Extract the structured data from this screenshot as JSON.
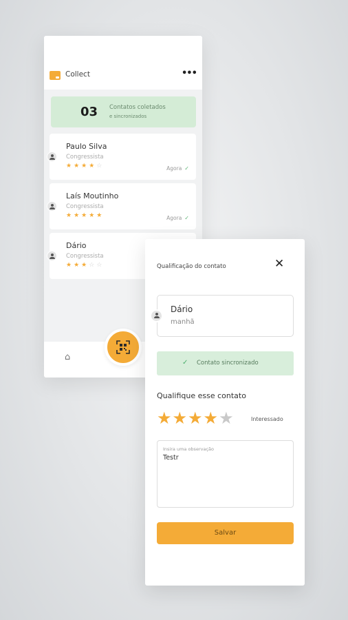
{
  "app": {
    "title": "Collect",
    "menu_icon": "more-horizontal-icon"
  },
  "summary": {
    "count": "03",
    "line1": "Contatos coletados",
    "line2": "e sincronizados"
  },
  "contacts": [
    {
      "name": "Paulo Silva",
      "role": "Congressista",
      "stars_filled": "★★★★",
      "stars_empty": "☆",
      "rating": 4,
      "status": "Agora",
      "synced": true
    },
    {
      "name": "Laís Moutinho",
      "role": "Congressista",
      "stars_filled": "★★★★★",
      "stars_empty": "",
      "rating": 5,
      "status": "Agora",
      "synced": true
    },
    {
      "name": "Dário",
      "role": "Congressista",
      "stars_filled": "★★★",
      "stars_empty": "☆☆",
      "rating": 3,
      "status": "",
      "synced": false
    }
  ],
  "nav": {
    "home_icon": "home-icon",
    "scan_icon": "qr-scan-icon"
  },
  "modal": {
    "title": "Qualificação do contato",
    "close_icon": "close-icon",
    "contact_name": "Dário",
    "contact_period": "manhã",
    "sync_text": "Contato sincronizado",
    "qualify_heading": "Qualifique esse contato",
    "rating": 4,
    "rating_max": 5,
    "rating_label": "Interessado",
    "observation_placeholder": "Insira uma observação",
    "observation_value": "Testr",
    "save_label": "Salvar"
  },
  "colors": {
    "accent": "#f4ab37",
    "success_bg": "#d4ecd6",
    "success": "#5bb374",
    "star_off": "#c9c9c9"
  }
}
